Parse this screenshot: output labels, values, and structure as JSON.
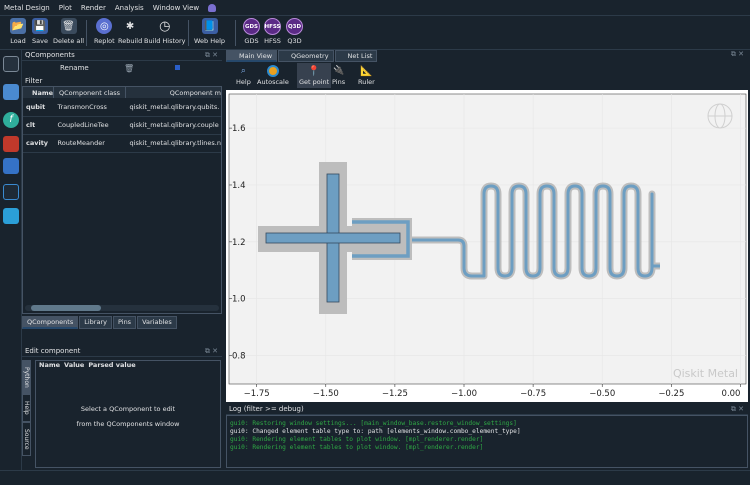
{
  "menu": [
    "Metal Design",
    "Plot",
    "Render",
    "Analysis",
    "Window View"
  ],
  "toolbar": {
    "load": "Load",
    "save": "Save",
    "delete_all": "Delete all",
    "replot": "Replot",
    "rebuild": "Rebuild",
    "build_history": "Build History",
    "web_help": "Web Help",
    "gds": "GDS",
    "hfss": "HFSS",
    "q3d": "Q3D"
  },
  "qcomponents": {
    "title": "QComponents",
    "rename": "Rename",
    "filter_label": "Filter",
    "columns": [
      "Name",
      "QComponent class",
      "QComponent m"
    ],
    "rows": [
      [
        "qubit",
        "TransmonCross",
        "qiskit_metal.qlibrary.qubits."
      ],
      [
        "clt",
        "CoupledLineTee",
        "qiskit_metal.qlibrary.couple"
      ],
      [
        "cavity",
        "RouteMeander",
        "qiskit_metal.qlibrary.tlines.n"
      ]
    ],
    "tabs": [
      "QComponents",
      "Library",
      "Pins",
      "Variables"
    ]
  },
  "edit_component": {
    "title": "Edit component",
    "columns": [
      "Name",
      "Value",
      "Parsed value"
    ],
    "message_line1": "Select a QComponent to edit",
    "message_line2": "from the QComponents window",
    "side_tabs": [
      "Python",
      "Help",
      "Source"
    ]
  },
  "view_tabs": [
    "Main View",
    "QGeometry",
    "Net List"
  ],
  "plot_toolbar": {
    "help": "Help",
    "autoscale": "Autoscale",
    "get_point": "Get point",
    "pins": "Pins",
    "ruler": "Ruler"
  },
  "plot": {
    "x_ticks": [
      "−1.75",
      "−1.50",
      "−1.25",
      "−1.00",
      "−0.75",
      "−0.50",
      "−0.25",
      "0.00"
    ],
    "y_ticks": [
      "1.6",
      "1.4",
      "1.2",
      "1.0",
      "0.8"
    ],
    "watermark": "Qiskit Metal",
    "xlim": [
      -1.85,
      0.02
    ],
    "ylim": [
      0.7,
      1.72
    ]
  },
  "log": {
    "title": "Log  (filter >= debug)",
    "lines": [
      {
        "text": "gui0: Restoring window settings... [main_window_base.restore_window_settings]",
        "color": "#2fa845"
      },
      {
        "text": "gui0: Changed element table type to: path [elements_window.combo_element_type]",
        "color": "#e0e1e3"
      },
      {
        "text": "gui0: Rendering element tables to plot window. [mpl_renderer.render]",
        "color": "#2fa845"
      },
      {
        "text": "gui0: Rendering element tables to plot window. [mpl_renderer.render]",
        "color": "#2fa845"
      }
    ]
  }
}
